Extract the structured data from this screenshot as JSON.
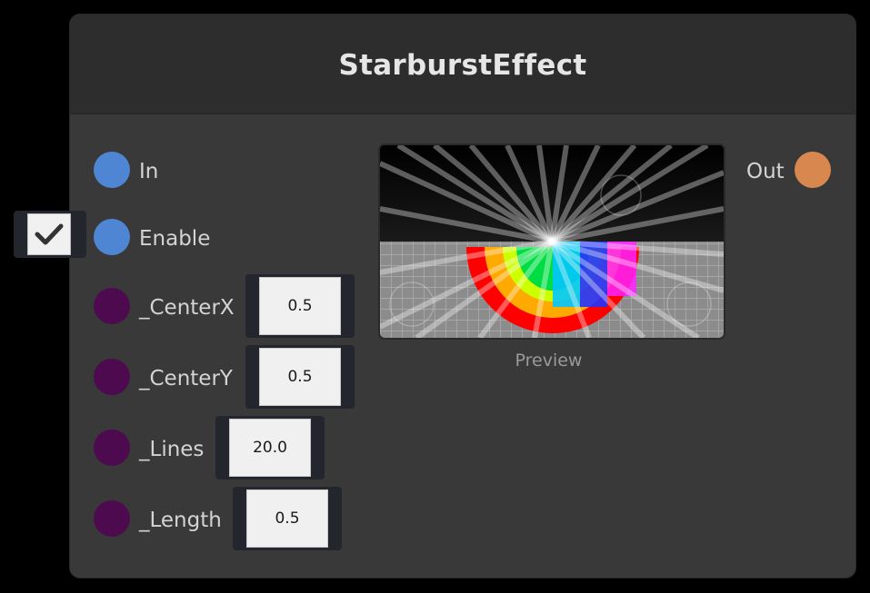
{
  "node": {
    "title": "StarburstEffect",
    "inputs": [
      {
        "label": "In",
        "type": "flow",
        "color": "#4f86d4"
      },
      {
        "label": "Enable",
        "type": "bool",
        "color": "#4f86d4",
        "checked": true
      },
      {
        "label": "_CenterX",
        "type": "float",
        "color": "#4d0a4f",
        "value": "0.5"
      },
      {
        "label": "_CenterY",
        "type": "float",
        "color": "#4d0a4f",
        "value": "0.5"
      },
      {
        "label": "_Lines",
        "type": "float",
        "color": "#4d0a4f",
        "value": "20.0"
      },
      {
        "label": "_Length",
        "type": "float",
        "color": "#4d0a4f",
        "value": "0.5"
      }
    ],
    "outputs": [
      {
        "label": "Out",
        "color": "#d8884f"
      }
    ],
    "preview": {
      "label": "Preview"
    }
  },
  "colors": {
    "canvas": "#000000",
    "node_body": "#393939",
    "node_header": "#2d2d2d",
    "flow_port": "#4f86d4",
    "float_port": "#4d0a4f",
    "output_port": "#d8884f"
  }
}
